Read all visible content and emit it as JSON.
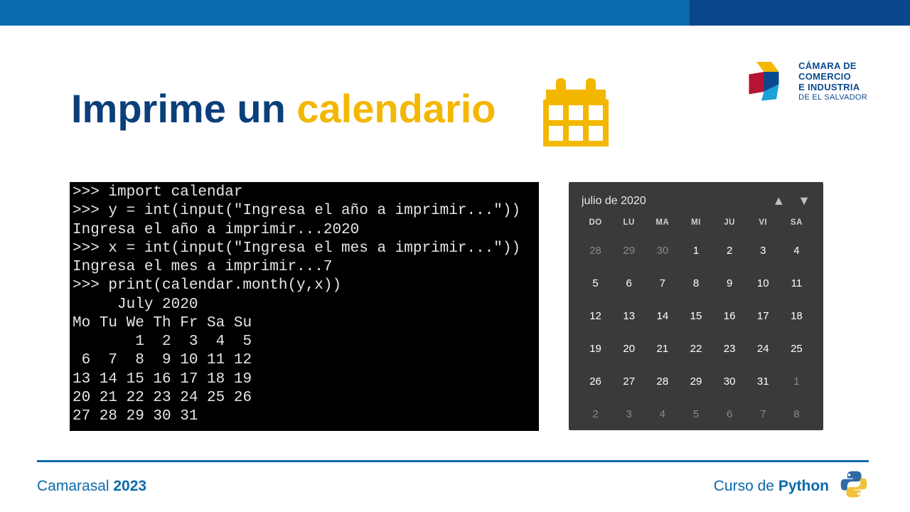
{
  "header": {
    "logo_text_line1": "CÁMARA DE",
    "logo_text_line2": "COMERCIO",
    "logo_text_line3": "E INDUSTRIA",
    "logo_text_line4": "DE EL SALVADOR"
  },
  "title": {
    "part1": "Imprime un ",
    "part2": "calendario"
  },
  "terminal": {
    "lines": ">>> import calendar\n>>> y = int(input(\"Ingresa el año a imprimir...\"))\nIngresa el año a imprimir...2020\n>>> x = int(input(\"Ingresa el mes a imprimir...\"))\nIngresa el mes a imprimir...7\n>>> print(calendar.month(y,x))\n     July 2020\nMo Tu We Th Fr Sa Su\n       1  2  3  4  5\n 6  7  8  9 10 11 12\n13 14 15 16 17 18 19\n20 21 22 23 24 25 26\n27 28 29 30 31"
  },
  "calendar": {
    "title": "julio de 2020",
    "dow": [
      "DO",
      "LU",
      "MA",
      "MI",
      "JU",
      "VI",
      "SA"
    ],
    "cells": [
      {
        "n": "28",
        "dim": true
      },
      {
        "n": "29",
        "dim": true
      },
      {
        "n": "30",
        "dim": true
      },
      {
        "n": "1"
      },
      {
        "n": "2"
      },
      {
        "n": "3"
      },
      {
        "n": "4"
      },
      {
        "n": "5"
      },
      {
        "n": "6"
      },
      {
        "n": "7"
      },
      {
        "n": "8"
      },
      {
        "n": "9"
      },
      {
        "n": "10"
      },
      {
        "n": "11"
      },
      {
        "n": "12"
      },
      {
        "n": "13"
      },
      {
        "n": "14"
      },
      {
        "n": "15"
      },
      {
        "n": "16"
      },
      {
        "n": "17"
      },
      {
        "n": "18"
      },
      {
        "n": "19"
      },
      {
        "n": "20"
      },
      {
        "n": "21"
      },
      {
        "n": "22"
      },
      {
        "n": "23"
      },
      {
        "n": "24"
      },
      {
        "n": "25"
      },
      {
        "n": "26"
      },
      {
        "n": "27"
      },
      {
        "n": "28"
      },
      {
        "n": "29"
      },
      {
        "n": "30"
      },
      {
        "n": "31"
      },
      {
        "n": "1",
        "dim": true
      },
      {
        "n": "2",
        "dim": true
      },
      {
        "n": "3",
        "dim": true
      },
      {
        "n": "4",
        "dim": true
      },
      {
        "n": "5",
        "dim": true
      },
      {
        "n": "6",
        "dim": true
      },
      {
        "n": "7",
        "dim": true
      },
      {
        "n": "8",
        "dim": true
      }
    ]
  },
  "footer": {
    "left_a": "Camarasal ",
    "left_b": "2023",
    "right_a": "Curso de ",
    "right_b": "Python"
  }
}
